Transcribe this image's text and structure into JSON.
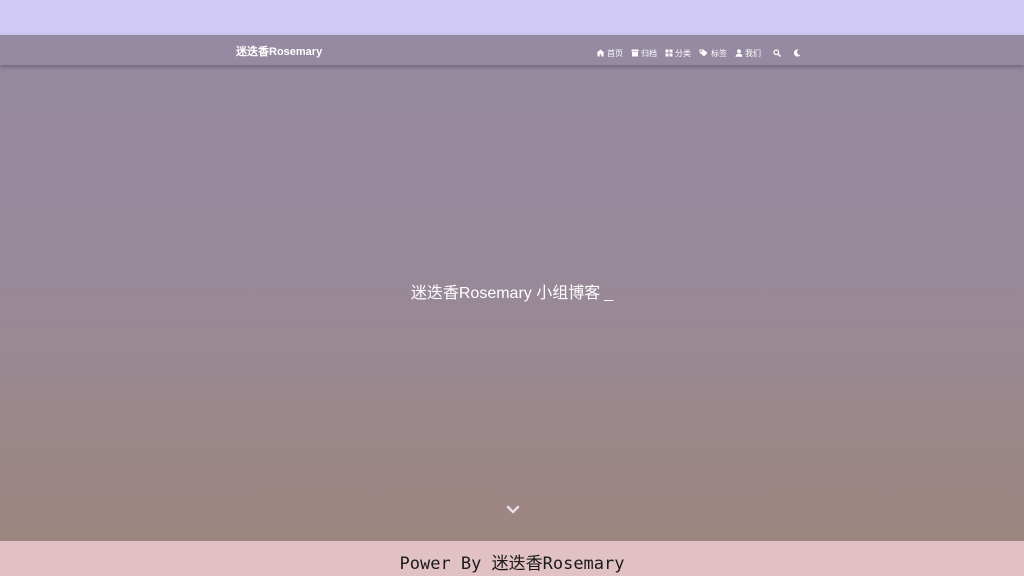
{
  "navbar": {
    "brand": "迷迭香Rosemary",
    "items": [
      {
        "label": "首页",
        "icon": "home-icon"
      },
      {
        "label": "归档",
        "icon": "archive-icon"
      },
      {
        "label": "分类",
        "icon": "category-grid-icon"
      },
      {
        "label": "标签",
        "icon": "tags-icon"
      },
      {
        "label": "我们",
        "icon": "user-icon"
      }
    ],
    "search_icon": "search-icon",
    "theme_icon": "moon-icon"
  },
  "hero": {
    "title": "迷迭香Rosemary 小组博客",
    "cursor": "_",
    "scroll_icon": "chevron-down-icon"
  },
  "footer": {
    "text": "Power By 迷迭香Rosemary"
  },
  "colors": {
    "top_band": "#d0c9f4",
    "navbar": "#958aa1",
    "hero_top": "#968aa0",
    "hero_bottom": "#9e8680",
    "footer": "#e2c1c4"
  }
}
